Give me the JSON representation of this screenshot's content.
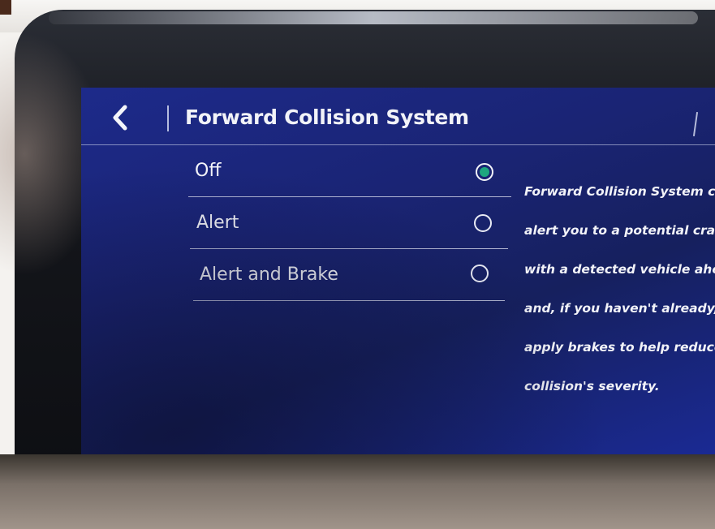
{
  "header": {
    "title": "Forward Collision System"
  },
  "options": [
    {
      "label": "Off",
      "selected": true
    },
    {
      "label": "Alert",
      "selected": false
    },
    {
      "label": "Alert and Brake",
      "selected": false
    }
  ],
  "description": {
    "lines": [
      "Forward Collision System ca",
      "alert you to a potential crash",
      "with a detected vehicle ahea",
      "and, if you haven't already, it",
      "apply brakes to help reduce a",
      "collision's severity."
    ]
  },
  "colors": {
    "screen_blue": "#1a2474",
    "selected_radio": "#1ea77f",
    "text": "#f2f3f8"
  },
  "icons": {
    "back": "chevron-left-icon"
  }
}
